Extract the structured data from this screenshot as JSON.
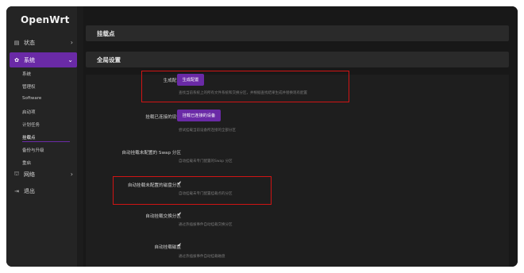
{
  "brand": "OpenWrt",
  "sidebar": {
    "items": [
      {
        "label": "状态",
        "icon": "status-icon",
        "glyph": "▤",
        "chevron": "›"
      },
      {
        "label": "系统",
        "icon": "gear-icon",
        "glyph": "✿",
        "chevron": "⌄"
      },
      {
        "label": "网络",
        "icon": "network-icon",
        "glyph": "⛫",
        "chevron": "›"
      },
      {
        "label": "退出",
        "icon": "logout-icon",
        "glyph": "⇥"
      }
    ],
    "subitems": [
      "系统",
      "管理权",
      "Software",
      "启动项",
      "计划任务",
      "挂载点",
      "备份与升级",
      "重启"
    ]
  },
  "header": {
    "title": "挂载点"
  },
  "section": {
    "title": "全局设置"
  },
  "settings": [
    {
      "label": "生成配置",
      "button": "生成配置",
      "desc": "查找当前系统上的所有文件系统和交换分区，并根据查找结果生成并替换现有配置"
    },
    {
      "label": "挂载已连接的设备",
      "button": "挂载已连接的设备",
      "desc": "尝试挂载当前设备所连接的全部分区"
    },
    {
      "label": "自动挂载未配置的 Swap 分区",
      "desc": "自动挂载未专门配置的Swap 分区"
    },
    {
      "label": "自动挂载未配置的磁盘分区",
      "check": "✔",
      "desc": "自动挂载未专门配置挂载点的分区"
    },
    {
      "label": "自动挂载交换分区",
      "check": "✔",
      "desc": "通过热插拔事件自动挂载交换分区"
    },
    {
      "label": "自动挂载磁盘",
      "check": "✔",
      "desc": "通过热插拔事件自动挂载磁盘"
    }
  ],
  "colors": {
    "accent": "#6a2aa6",
    "highlight": "#d01414"
  }
}
